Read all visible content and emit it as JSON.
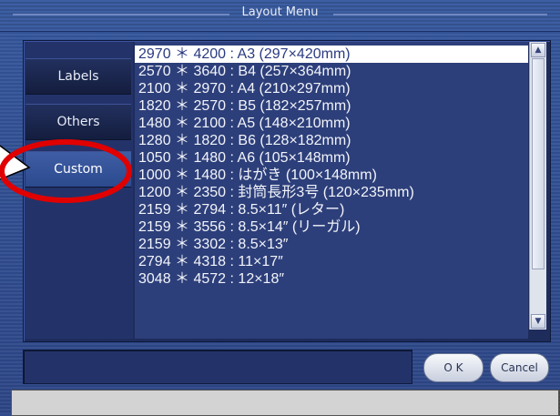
{
  "window": {
    "title": "Layout Menu"
  },
  "sidebar": {
    "items": [
      {
        "label": "Labels"
      },
      {
        "label": "Others"
      },
      {
        "label": "Custom"
      }
    ]
  },
  "list": {
    "items": [
      "2970 ＊ 4200 : A3 (297×420mm)",
      "2570 ＊ 3640 : B4 (257×364mm)",
      "2100 ＊ 2970 : A4 (210×297mm)",
      "1820 ＊ 2570 : B5 (182×257mm)",
      "1480 ＊ 2100 : A5 (148×210mm)",
      "1280 ＊ 1820 : B6 (128×182mm)",
      "1050 ＊ 1480 : A6 (105×148mm)",
      "1000 ＊ 1480 : はがき (100×148mm)",
      "1200 ＊ 2350 : 封筒長形3号 (120×235mm)",
      "2159 ＊ 2794 : 8.5×11″ (レター)",
      "2159 ＊ 3556 : 8.5×14″ (リーガル)",
      "2159 ＊ 3302 : 8.5×13″",
      "2794 ＊ 4318 : 11×17″",
      "3048 ＊ 4572 : 12×18″"
    ]
  },
  "buttons": {
    "ok": "O K",
    "cancel": "Cancel"
  },
  "input": {
    "value": ""
  },
  "colors": {
    "accent": "#2f4a8c",
    "highlight": "#e00000"
  }
}
